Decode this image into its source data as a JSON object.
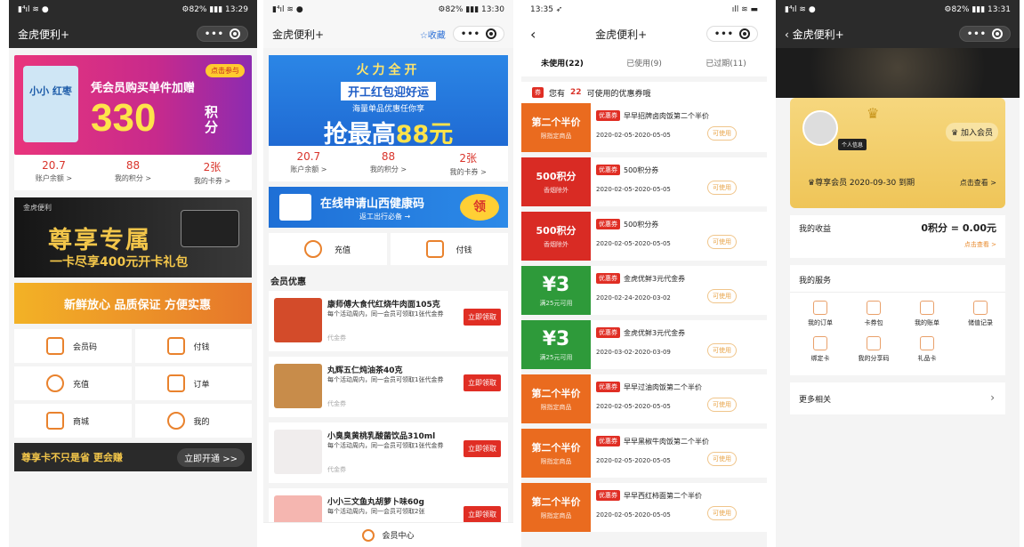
{
  "p1": {
    "status": {
      "left": "▮⁴ıl ≋ ●",
      "right": "⚙82% ▮▮▮ 13:29"
    },
    "title": "金虎便利+",
    "banner": {
      "tag": "点击参与",
      "pkg": "小小\n红枣",
      "sub": "凭会员购买单件加赠",
      "big": "330",
      "unit": "积分"
    },
    "stats": [
      {
        "v": "20.7",
        "l": "账户余额 >"
      },
      {
        "v": "88",
        "l": "我的积分 >"
      },
      {
        "v": "2张",
        "l": "我的卡券 >"
      }
    ],
    "premium": {
      "t1": "金虎便利",
      "t2": "尊享专属",
      "t3": "一卡尽享400元开卡礼包"
    },
    "grocery": "新鲜放心 品质保证 方便实惠",
    "menu": [
      [
        "会员码",
        "付钱"
      ],
      [
        "充值",
        "订单"
      ],
      [
        "商城",
        "我的"
      ]
    ],
    "open": {
      "a": "尊享卡不只是省 更会赚",
      "b": "立即开通 >>"
    }
  },
  "p2": {
    "status": {
      "left": "▮⁴ıl ≋ ●",
      "right": "⚙82% ▮▮▮ 13:30"
    },
    "title": "金虎便利+",
    "fav": "☆收藏",
    "banner": {
      "a": "火力全开",
      "b": "开工红包迎好运",
      "c": "海量单品优惠任你享",
      "d1": "抢最高",
      "d2": "88元"
    },
    "stats": [
      {
        "v": "20.7",
        "l": "账户余额 >"
      },
      {
        "v": "88",
        "l": "我的积分 >"
      },
      {
        "v": "2张",
        "l": "我的卡券 >"
      }
    ],
    "health": {
      "a": "在线申请山西健康码",
      "b": "返工出行必备 →",
      "btn": "领"
    },
    "pay": [
      "充值",
      "付钱"
    ],
    "section": "会员优惠",
    "coupons": [
      {
        "title": "康师傅大食代红烧牛肉面105克",
        "desc": "每个活动周内，同一会员可领取1张代金券",
        "sm": "代金券",
        "btn": "立即领取"
      },
      {
        "title": "丸辉五仁炖油茶40克",
        "desc": "每个活动周内，同一会员可领取1张代金券",
        "sm": "代金券",
        "btn": "立即领取"
      },
      {
        "title": "小臭臭黄桃乳酸菌饮品310ml",
        "desc": "每个活动周内，同一会员可领取1张代金券",
        "sm": "代金券",
        "btn": "立即领取"
      },
      {
        "title": "小小三文鱼丸胡萝卜味60g",
        "desc": "每个活动周内，同一会员可领取2张",
        "sm": "",
        "btn": "立即领取"
      }
    ],
    "bottom": "会员中心"
  },
  "p3": {
    "status": {
      "left": "13:35 ➶",
      "right": "ıll ≋ ▬"
    },
    "title": "金虎便利+",
    "tabs": [
      "未使用(22)",
      "已使用(9)",
      "已过期(11)"
    ],
    "notice": {
      "pre": "您有",
      "n": "22",
      "post": "可使用的优惠券哦"
    },
    "tickets": [
      {
        "color": "orange",
        "big": "第二个半价",
        "sm": "限指定商品",
        "badge": "优惠券",
        "title": "早早招牌卤肉饭第二个半价",
        "date": "2020-02-05-2020-05-05",
        "use": "可使用"
      },
      {
        "color": "red",
        "big": "500积分",
        "sm": "香烟除外",
        "badge": "优惠券",
        "title": "500积分券",
        "date": "2020-02-05-2020-05-05",
        "use": "可使用"
      },
      {
        "color": "red",
        "big": "500积分",
        "sm": "香烟除外",
        "badge": "优惠券",
        "title": "500积分券",
        "date": "2020-02-05-2020-05-05",
        "use": "可使用"
      },
      {
        "color": "green",
        "big": "¥3",
        "sm": "满25元可用",
        "badge": "优惠券",
        "title": "金虎优鲜3元代金券",
        "date": "2020-02-24-2020-03-02",
        "use": "可使用"
      },
      {
        "color": "green",
        "big": "¥3",
        "sm": "满25元可用",
        "badge": "优惠券",
        "title": "金虎优鲜3元代金券",
        "date": "2020-03-02-2020-03-09",
        "use": "可使用"
      },
      {
        "color": "orange",
        "big": "第二个半价",
        "sm": "限指定商品",
        "badge": "优惠券",
        "title": "早早过油肉饭第二个半价",
        "date": "2020-02-05-2020-05-05",
        "use": "可使用"
      },
      {
        "color": "orange",
        "big": "第二个半价",
        "sm": "限指定商品",
        "badge": "优惠券",
        "title": "早早黑椒牛肉饭第二个半价",
        "date": "2020-02-05-2020-05-05",
        "use": "可使用"
      },
      {
        "color": "orange",
        "big": "第二个半价",
        "sm": "限指定商品",
        "badge": "优惠券",
        "title": "早早西红柿面第二个半价",
        "date": "2020-02-05-2020-05-05",
        "use": "可使用"
      }
    ]
  },
  "p4": {
    "status": {
      "left": "▮⁴ıl ≋ ●",
      "right": "⚙82% ▮▮▮ 13:31"
    },
    "title": "‹ 金虎便利+",
    "card": {
      "tag": "个人信息",
      "join": "♛ 加入会员",
      "exp": "♛尊享会员 2020-09-30 到期",
      "see": "点击查看 >"
    },
    "income": {
      "a": "我的收益",
      "b": "0积分 = 0.00元",
      "c": "点击查看 >"
    },
    "services": {
      "title": "我的服务",
      "items": [
        "我的订单",
        "卡券包",
        "我的账单",
        "储值记录",
        "绑定卡",
        "我的分享码",
        "礼品卡"
      ]
    },
    "more": {
      "a": "更多相关",
      "b": "›"
    }
  }
}
